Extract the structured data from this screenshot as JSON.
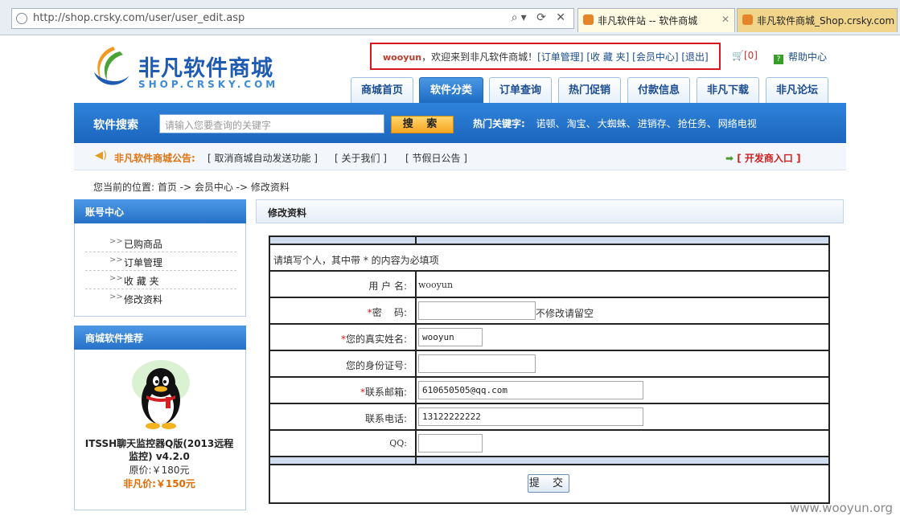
{
  "browser": {
    "url": "http://shop.crsky.com/user/user_edit.asp",
    "tabs": [
      {
        "label": "非凡软件站 -- 软件商城"
      },
      {
        "label": "非凡软件商城_Shop.crsky.com"
      }
    ]
  },
  "logo": {
    "cn": "非凡软件商城",
    "en": "SHOP.CRSKY.COM"
  },
  "top": {
    "user": "wooyun",
    "welcome": "，欢迎来到非凡软件商城！",
    "links": [
      "[订单管理]",
      "[收 藏 夹]",
      "[会员中心]",
      "[退出]"
    ],
    "cart": "[0]",
    "help": "帮助中心"
  },
  "nav": [
    "商城首页",
    "软件分类",
    "订单查询",
    "热门促销",
    "付款信息",
    "非凡下载",
    "非凡论坛"
  ],
  "search": {
    "label": "软件搜索",
    "placeholder": "请输入您要查询的关键字",
    "button": "搜 索",
    "hot_label": "热门关键字:",
    "hot": [
      "诺顿",
      "淘宝",
      "大蜘蛛",
      "进销存",
      "抢任务",
      "网络电视"
    ]
  },
  "notice": {
    "title": "非凡软件商城公告:",
    "items": [
      "[ 取消商城自动发送功能 ]",
      "[ 关于我们 ]",
      "[ 节假日公告 ]"
    ],
    "dev": "[ 开发商入口 ]"
  },
  "crumb": "您当前的位置:  首页 -> 会员中心 -> 修改资料",
  "sidebar": {
    "account_title": "账号中心",
    "items": [
      "已购商品",
      "订单管理",
      "收 藏 夹",
      "修改资料"
    ],
    "rec_title": "商城软件推荐",
    "product": {
      "name": "ITSSH聊天监控器Q版(2013远程监控) v4.2.0",
      "price": "原价:￥180元",
      "sale": "非凡价:￥150元"
    }
  },
  "main": {
    "title": "修改资料",
    "hint": "请填写个人，其中带 * 的内容为必填项",
    "fields": {
      "username_label": "用 户 名:",
      "username": "wooyun",
      "password_label": "密    码:",
      "password_note": "不修改请留空",
      "realname_label": "您的真实姓名:",
      "realname": "wooyun",
      "idcard_label": "您的身份证号:",
      "idcard": "",
      "email_label": "联系邮箱:",
      "email": "610650505@qq.com",
      "phone_label": "联系电话:",
      "phone": "13122222222",
      "qq_label": "QQ:",
      "qq": ""
    },
    "required_mark": "*",
    "submit": "提 交"
  },
  "watermark": "www.wooyun.org"
}
